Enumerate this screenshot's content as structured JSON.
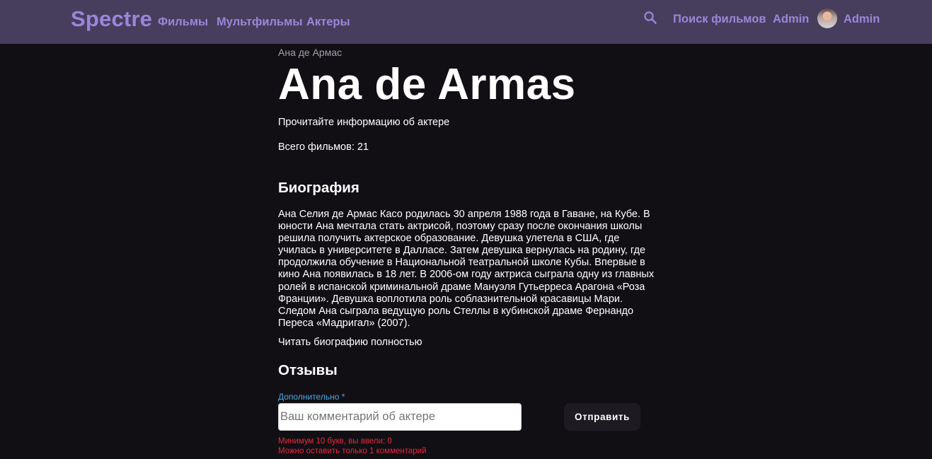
{
  "header": {
    "brand": "Spectre",
    "nav": [
      "Фильмы",
      "Мультфильмы",
      "Актеры"
    ],
    "search_label": "Поиск фильмов",
    "admin_link": "Admin",
    "user_name": "Admin",
    "search_icon": "magnifier-icon",
    "colors": {
      "bar": "#473e5e",
      "accent": "#9a86d8"
    }
  },
  "actor": {
    "breadcrumb": "Ана де Армас",
    "name": "Ana de Armas",
    "lead": "Прочитайте информацию об актере",
    "films_label": "Всего фильмов:",
    "films_count": "21"
  },
  "biography": {
    "heading": "Биография",
    "text": "Ана Селия де Армас Касо родилась 30 апреля 1988 года в Гаване, на Кубе. В юности Ана мечтала стать актрисой, поэтому сразу после окончания школы решила получить актерское образование. Девушка улетела в США, где училась в университете в Далласе. Затем девушка вернулась на родину, где продолжила обучение в Национальной театральной школе Кубы. Впервые в кино Ана появилась в 18 лет. В 2006-ом году актриса сыграла одну из главных ролей в испанской криминальной драме Мануэля Гутьерреса Арагона «Роза Франции». Девушка воплотила роль соблазнительной красавицы Мари. Следом Ана сыграла ведущую роль Стеллы в кубинской драме Фернандо Пересa «Мадригал» (2007).",
    "read_more": "Читать биографию полностью"
  },
  "reviews": {
    "heading": "Отзывы",
    "field_label": "Дополнительно *",
    "input_value": "",
    "placeholder": "Ваш комментарий об актере",
    "submit_label": "Отправить",
    "error_min_length": "Минимум 10 букв, вы ввели: 0",
    "error_one_comment": "Можно оставить только 1 комментарий",
    "colors": {
      "label": "#47a9e2",
      "error": "#e5293b"
    }
  }
}
